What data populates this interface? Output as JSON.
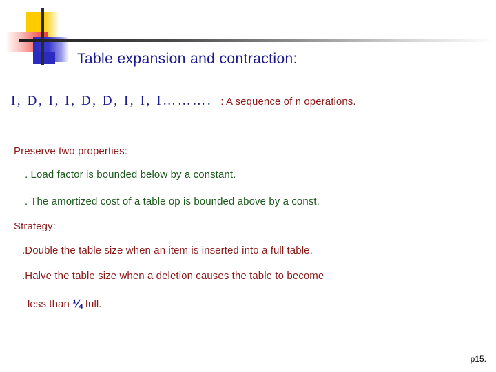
{
  "slide": {
    "title": "Table expansion and contraction:",
    "page_number": "p15.",
    "colors": {
      "title_blue": "#1B1B8F",
      "body_red": "#8B1A1A",
      "body_green": "#1C5A1C",
      "logo_yellow": "#FFCC00",
      "logo_red": "#EE3A33",
      "logo_blue": "#2B2BC0",
      "rule_dark": "#1C1C1C"
    },
    "sequence": {
      "operations": "I,  D,  I,  I,  D,  D,  I,  I,  I……….",
      "note": ": A sequence of n operations."
    },
    "properties": {
      "heading": "Preserve two properties:",
      "items": [
        ". Load factor is bounded below by a constant.",
        ". The amortized cost of a table op is bounded above by a const."
      ]
    },
    "strategy": {
      "heading": "Strategy:",
      "items": [
        ".Double the table size when an item is inserted into a full table.",
        ".Halve the table size when a deletion causes the table to become"
      ],
      "continuation_prefix": "less than ",
      "continuation_fraction": "¼",
      "continuation_suffix": " full."
    }
  }
}
